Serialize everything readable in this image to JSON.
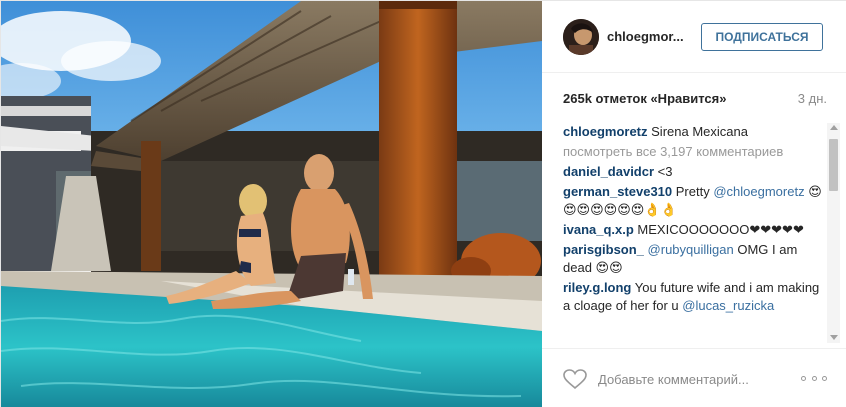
{
  "header": {
    "username": "chloegmor...",
    "follow_label": "ПОДПИСАТЬСЯ"
  },
  "meta": {
    "likes": "265k отметок «Нравится»",
    "time": "3 дн."
  },
  "caption": {
    "user": "chloegmoretz",
    "text": "Sirena Mexicana"
  },
  "view_all": "посмотреть все 3,197 комментариев",
  "comments": [
    {
      "user": "daniel_davidcr",
      "text": " <3",
      "mention": ""
    },
    {
      "user": "german_steve310",
      "text": " Pretty ",
      "mention": "@chloegmoretz",
      "tail": " 😍😍😍😍😍😍😍👌👌"
    },
    {
      "user": "ivana_q.x.p",
      "text": " MEXICOOOOOOO❤❤❤❤❤",
      "mention": ""
    },
    {
      "user": "parisgibson_",
      "text": " ",
      "mention": "@rubyquilligan",
      "tail": " OMG I am dead 😍😍"
    },
    {
      "user": "riley.g.long",
      "text": " You future wife and i am making a cloage of her for u ",
      "mention": "@lucas_ruzicka"
    }
  ],
  "footer": {
    "comment_placeholder": "Добавьте комментарий..."
  },
  "colors": {
    "follow": "#3f729b",
    "username": "#12406b",
    "muted": "#8a8a8a"
  }
}
